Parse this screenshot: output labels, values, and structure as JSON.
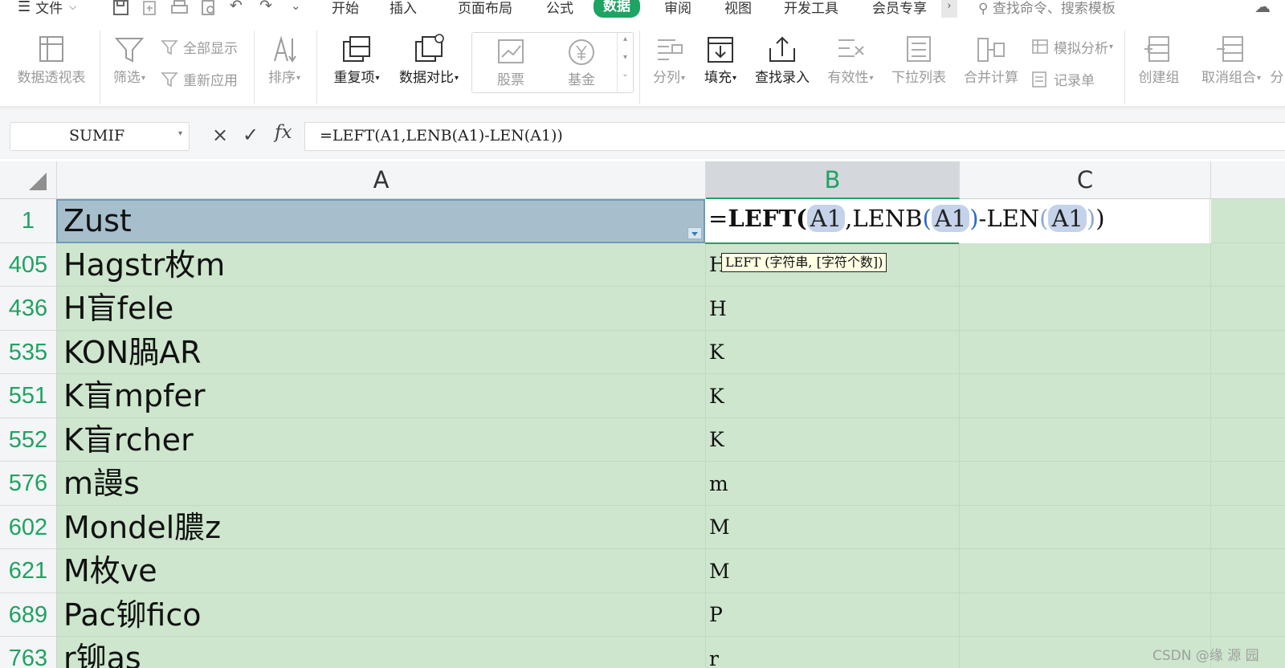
{
  "menubar": {
    "file_label": "文件",
    "tabs": [
      {
        "label": "开始",
        "active": false
      },
      {
        "label": "插入",
        "active": false
      },
      {
        "label": "页面布局",
        "active": false
      },
      {
        "label": "公式",
        "active": false
      },
      {
        "label": "数据",
        "active": true
      },
      {
        "label": "审阅",
        "active": false
      },
      {
        "label": "视图",
        "active": false
      },
      {
        "label": "开发工具",
        "active": false
      },
      {
        "label": "会员专享",
        "active": false
      }
    ],
    "more_symbol": "›",
    "search_placeholder": "查找命令、搜索模板",
    "accent_color": "#1ea362"
  },
  "ribbon": {
    "pivot": "数据透视表",
    "filter": "筛选",
    "show_all": "全部显示",
    "reapply": "重新应用",
    "sort": "排序",
    "duplicates": "重复项",
    "compare": "数据对比",
    "stock": "股票",
    "fund": "基金",
    "split_column": "分列",
    "fill": "填充",
    "lookup_entry": "查找录入",
    "validity": "有效性",
    "dropdown_list": "下拉列表",
    "consolidate": "合并计算",
    "what_if": "模拟分析",
    "record_form": "记录单",
    "create_group": "创建组",
    "ungroup": "取消组合",
    "more_partial": "分"
  },
  "formula_bar": {
    "name_box": "SUMIF",
    "cancel_symbol": "×",
    "confirm_symbol": "✓",
    "fx_label": "fx",
    "formula": "=LEFT(A1,LENB(A1)-LEN(A1))"
  },
  "sheet": {
    "columns": [
      "A",
      "B",
      "C"
    ],
    "selected_column": "B",
    "rows": [
      {
        "num": "1",
        "a": "Zust",
        "b": ""
      },
      {
        "num": "405",
        "a": "Hagstr枚m",
        "b": "H"
      },
      {
        "num": "436",
        "a": "H盲fele",
        "b": "H"
      },
      {
        "num": "535",
        "a": "KON腡AR",
        "b": "K"
      },
      {
        "num": "551",
        "a": "K盲mpfer",
        "b": "K"
      },
      {
        "num": "552",
        "a": "K盲rcher",
        "b": "K"
      },
      {
        "num": "576",
        "a": "m謾s",
        "b": "m"
      },
      {
        "num": "602",
        "a": "Mondel膿z",
        "b": "M"
      },
      {
        "num": "621",
        "a": "M枚ve",
        "b": "M"
      },
      {
        "num": "689",
        "a": "Pac铆fico",
        "b": "P"
      },
      {
        "num": "763",
        "a": "r铆as",
        "b": "r"
      }
    ],
    "editor": {
      "eq": "=",
      "fn_left": "LEFT",
      "open1": "(",
      "ref1": "A1",
      "comma": ",",
      "fn_lenb": "LENB",
      "open2": "(",
      "ref2": "A1",
      "close2": ")",
      "minus": "-",
      "fn_len": "LEN",
      "open3": "(",
      "ref3": "A1",
      "close3": ")",
      "close1": ")"
    },
    "tooltip": "LEFT (字符串, [字符个数])"
  },
  "watermark": "CSDN @缘 源 园"
}
